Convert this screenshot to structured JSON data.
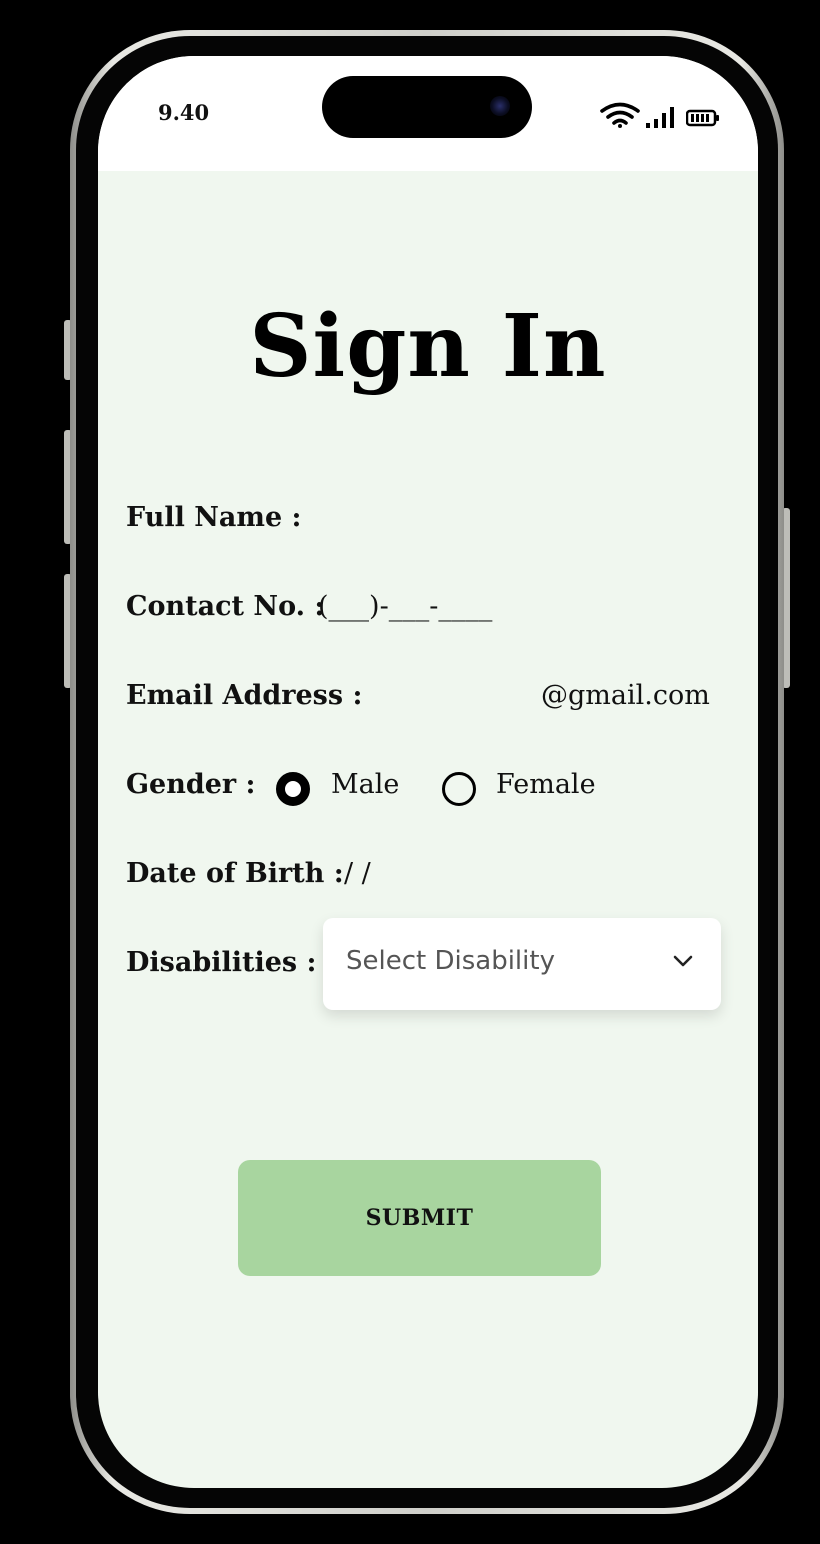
{
  "status_bar": {
    "time": "9.40",
    "icons": [
      "wifi-icon",
      "signal-icon",
      "battery-icon"
    ]
  },
  "page": {
    "title": "Sign In"
  },
  "form": {
    "full_name": {
      "label": "Full Name :"
    },
    "contact": {
      "label": "Contact No. :",
      "mask": "(___)-___-____"
    },
    "email": {
      "label": "Email Address :",
      "suffix": "@gmail.com"
    },
    "gender": {
      "label": "Gender :",
      "options": [
        {
          "label": "Male",
          "selected": true
        },
        {
          "label": "Female",
          "selected": false
        }
      ]
    },
    "dob": {
      "label": "Date of Birth :",
      "mask": "/ /"
    },
    "disabilities": {
      "label": "Disabilities :",
      "placeholder": "Select Disability"
    }
  },
  "submit": {
    "label": "SUBMIT"
  },
  "colors": {
    "screen_bg": "#f0f7ef",
    "submit_bg": "#a8d59f",
    "status_bar_bg": "#ffffff"
  }
}
